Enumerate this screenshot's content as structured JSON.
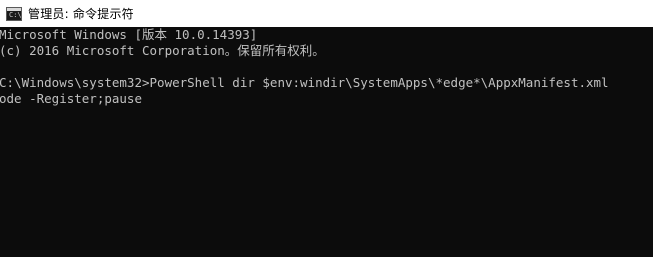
{
  "window": {
    "title": "管理员: 命令提示符",
    "icon": "cmd-icon",
    "icon_text": "C:\\"
  },
  "console": {
    "lines": [
      "Microsoft Windows [版本 10.0.14393]",
      "(c) 2016 Microsoft Corporation。保留所有权利。",
      "",
      "C:\\Windows\\system32>PowerShell dir $env:windir\\SystemApps\\*edge*\\AppxManifest.xml",
      "ode -Register;pause"
    ],
    "colors": {
      "background": "#0c0c0c",
      "text": "#c0c0c0"
    }
  }
}
